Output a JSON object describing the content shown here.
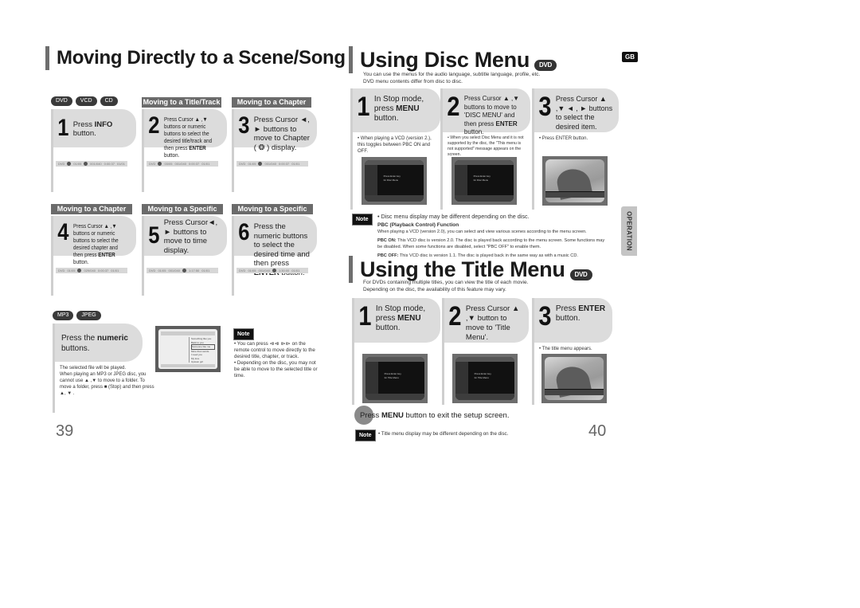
{
  "left_page": {
    "title": "Moving Directly to a Scene/Song",
    "disc_badges": [
      "DVD",
      "VCD",
      "CD"
    ],
    "headers": {
      "step2": "Moving to a Title/Track",
      "step3": "Moving to a Chapter",
      "step4": "Moving to a Chapter",
      "step5": "Moving to a Specific Time",
      "step6": "Moving to a Specific Time"
    },
    "steps": [
      {
        "num": "1",
        "pre": "Press ",
        "bold": "INFO",
        "post": " button."
      },
      {
        "num": "2",
        "pre": "Press Cursor ▲ ,▼ buttons or numeric buttons to select the desired title/track and then press ",
        "bold": "ENTER",
        "post": " button."
      },
      {
        "num": "3",
        "pre": "Press Cursor ◄, ► buttons to move to Chapter ( ❂ ) display.",
        "bold": "",
        "post": ""
      },
      {
        "num": "4",
        "pre": "Press Cursor ▲ ,▼ buttons or numeric buttons to select the desired chapter and then press ",
        "bold": "ENTER",
        "post": " button."
      },
      {
        "num": "5",
        "pre": "Press Cursor◄, ► buttons to move to time display.",
        "bold": "",
        "post": ""
      },
      {
        "num": "6",
        "pre": "Press the numeric buttons to select the desired time and then press ",
        "bold": "ENTER",
        "post": " button."
      }
    ],
    "osd_bars": [
      [
        "DVD",
        "01/05",
        "001/040",
        "0:00:37",
        "01/01"
      ],
      [
        "DVD",
        "03/05",
        "001/040",
        "0:00:37",
        "01/01"
      ],
      [
        "DVD",
        "01/05",
        "001/040",
        "0:00:37",
        "01/01"
      ],
      [
        "DVD",
        "01/05",
        "029/040",
        "0:00:37",
        "01/01"
      ],
      [
        "DVD",
        "01/05",
        "001/040",
        "1:17:50",
        "01/01"
      ],
      [
        "DVD",
        "01/05",
        "001/040",
        "1:30:00",
        "01/01"
      ]
    ],
    "mp3": {
      "badges": [
        "MP3",
        "JPEG"
      ],
      "step_pre": "Press the ",
      "step_bold": "numeric",
      "step_post": " buttons.",
      "bullets": [
        "The selected file will be played.",
        "When playing an MP3 or JPEG disc, you cannot use ▲ ,▼ to move to a folder. To move a folder, press ■ (Stop) and then press ▲, ▼ ."
      ],
      "screen_items": [
        "Something like you",
        "Back to you",
        "Someone like me",
        "More than words",
        "I need you",
        "My love",
        "Uptown girl"
      ]
    },
    "note": {
      "tag": "Note",
      "bullets": [
        "You can press ⧏⧏ ⧐⧐ on the remote control to move directly to the desired title, chapter, or track.",
        "Depending on the disc, you may not be able to move to the selected title or time."
      ]
    },
    "page_number": "39"
  },
  "right_page": {
    "gb_badge": "GB",
    "side_tab": "OPERATION",
    "disc_menu": {
      "title": "Using Disc Menu",
      "badge": "DVD",
      "intro": [
        "You can use the menus for the audio language, subtitle language, profile, etc.",
        "DVD menu contents differ from disc to disc."
      ],
      "steps": [
        {
          "num": "1",
          "pre": "In Stop mode, press ",
          "bold": "MENU",
          "post": " button.",
          "bullet": "When playing a VCD (version 2.), this toggles between PBC ON and OFF."
        },
        {
          "num": "2",
          "pre": "Press Cursor ▲ ,▼ buttons to move to 'DISC MENU' and then press ",
          "bold": "ENTER",
          "post": " button.",
          "bullet": "When you select Disc Menu and it is not supported by the disc, the \"This menu is not supported\" message appears on the screen."
        },
        {
          "num": "3",
          "pre": "Press Cursor ▲ ,▼ ◄ , ► buttons to select the desired item.",
          "bold": "",
          "post": "",
          "bullet": "Press ENTER button."
        }
      ],
      "screen_msg": [
        "Press Enter key",
        "for Disc Menu"
      ],
      "note": {
        "tag": "Note",
        "line1": "• Disc menu display may be different depending on the disc.",
        "pbc_title": "PBC (Playback Control) Function",
        "pbc_desc": "When playing a VCD (version 2.0), you can select and view various scenes according to the menu screen.",
        "pbc_on_label": "PBC ON:",
        "pbc_on": "This VCD disc is version 2.0. The disc is played back according to the menu screen. Some functions may be disabled. When some functions are disabled, select \"PBC OFF\" to enable them.",
        "pbc_off_label": "PBC OFF:",
        "pbc_off": "This VCD disc is version 1.1. The disc is played back in the same way as with a music CD."
      }
    },
    "title_menu": {
      "title": "Using the Title Menu",
      "badge": "DVD",
      "intro": [
        "For DVDs containing multiple titles, you can view the title of each movie.",
        "Depending on the disc, the availability of this feature may vary."
      ],
      "steps": [
        {
          "num": "1",
          "pre": "In Stop mode, press ",
          "bold": "MENU",
          "post": " button.",
          "bullet": ""
        },
        {
          "num": "2",
          "pre": "Press Cursor ▲ ,▼ button to move to 'Title Menu'.",
          "bold": "",
          "post": "",
          "bullet": ""
        },
        {
          "num": "3",
          "pre": "Press ",
          "bold": "ENTER",
          "post": " button.",
          "bullet": "The title menu appears."
        }
      ],
      "screen_msg": [
        "Press Enter key",
        "for Title Menu"
      ],
      "exit_pre": "Press ",
      "exit_bold": "MENU",
      "exit_post": " button to exit the setup screen.",
      "note_tag": "Note",
      "note_text": "• Title menu display may be different depending on the disc."
    },
    "page_number": "40"
  }
}
